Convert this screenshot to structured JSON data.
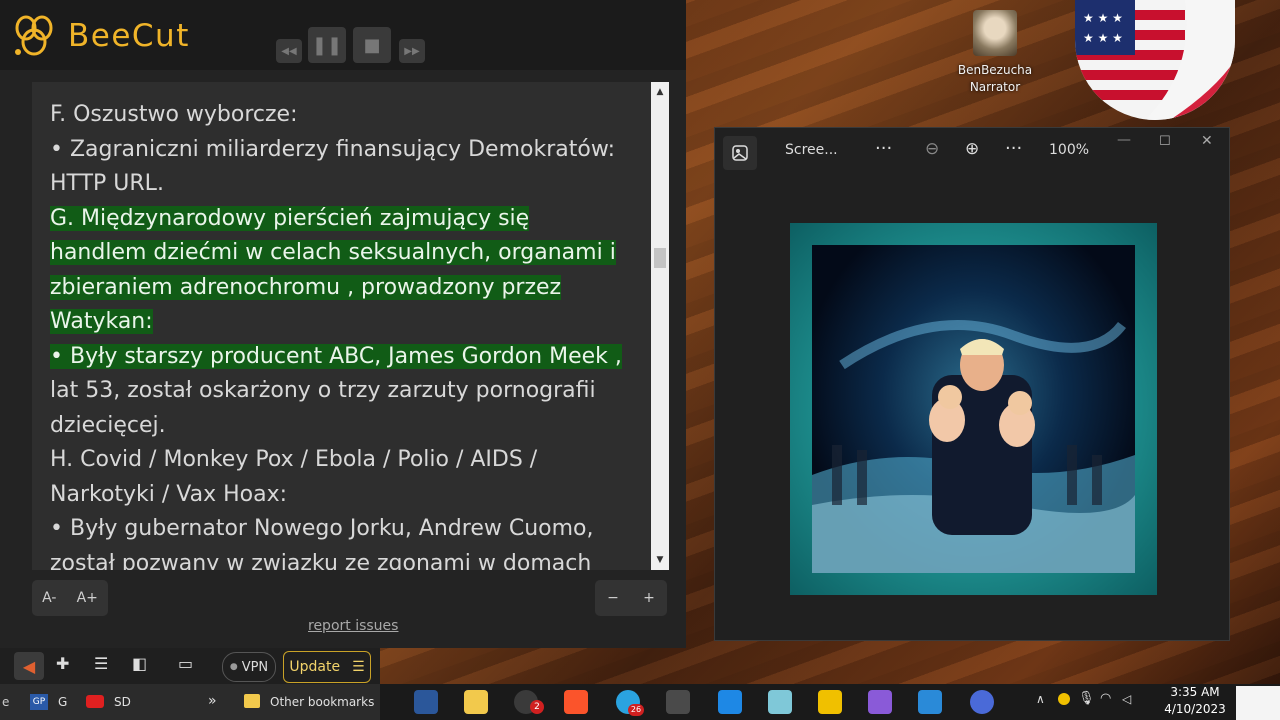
{
  "beecut": {
    "app_name": "BeeCut",
    "lines": [
      {
        "text": "F. Oszustwo wyborcze:",
        "hl": false
      },
      {
        "text": "• Zagraniczni miliarderzy finansujący Demokratów:",
        "hl": false
      },
      {
        "text": "HTTP URL.",
        "hl": false
      },
      {
        "text": "G. Międzynarodowy pierścień zajmujący się",
        "hl": true
      },
      {
        "text": "handlem dziećmi w celach seksualnych, organami i",
        "hl": true
      },
      {
        "text": "zbieraniem adrenochromu , prowadzony przez",
        "hl": true
      },
      {
        "text": "Watykan:",
        "hl": true
      },
      {
        "text": "• Były starszy producent ABC, James Gordon Meek ,",
        "hl": true
      },
      {
        "text": "lat 53, został oskarżony o trzy zarzuty pornografii",
        "hl": false
      },
      {
        "text": "dziecięcej.",
        "hl": false
      },
      {
        "text": "H. Covid / Monkey Pox / Ebola / Polio / AIDS /",
        "hl": false
      },
      {
        "text": "Narkotyki / Vax Hoax:",
        "hl": false
      },
      {
        "text": "• Były gubernator Nowego Jorku, Andrew Cuomo,",
        "hl": false
      },
      {
        "text": "został pozwany w związku ze zgonami w domach",
        "hl": false
      }
    ],
    "font_decrease": "A-",
    "font_increase": "A+",
    "zoom_out": "−",
    "zoom_in": "+",
    "report_link": "report issues"
  },
  "narrator": {
    "name": "BenBezucha",
    "role": "Narrator"
  },
  "viewer": {
    "title": "Scree...",
    "more": "···",
    "more2": "···",
    "zoom_level": "100%"
  },
  "browser": {
    "vpn_label": "VPN",
    "update_label": "Update",
    "bookmark_1": "G",
    "bookmark_2": "SD",
    "overflow": "»",
    "other_bookmarks": "Other bookmarks"
  },
  "taskbar": {
    "time": "3:35 AM",
    "date": "4/10/2023",
    "badge_1": "2",
    "badge_2": "26"
  }
}
